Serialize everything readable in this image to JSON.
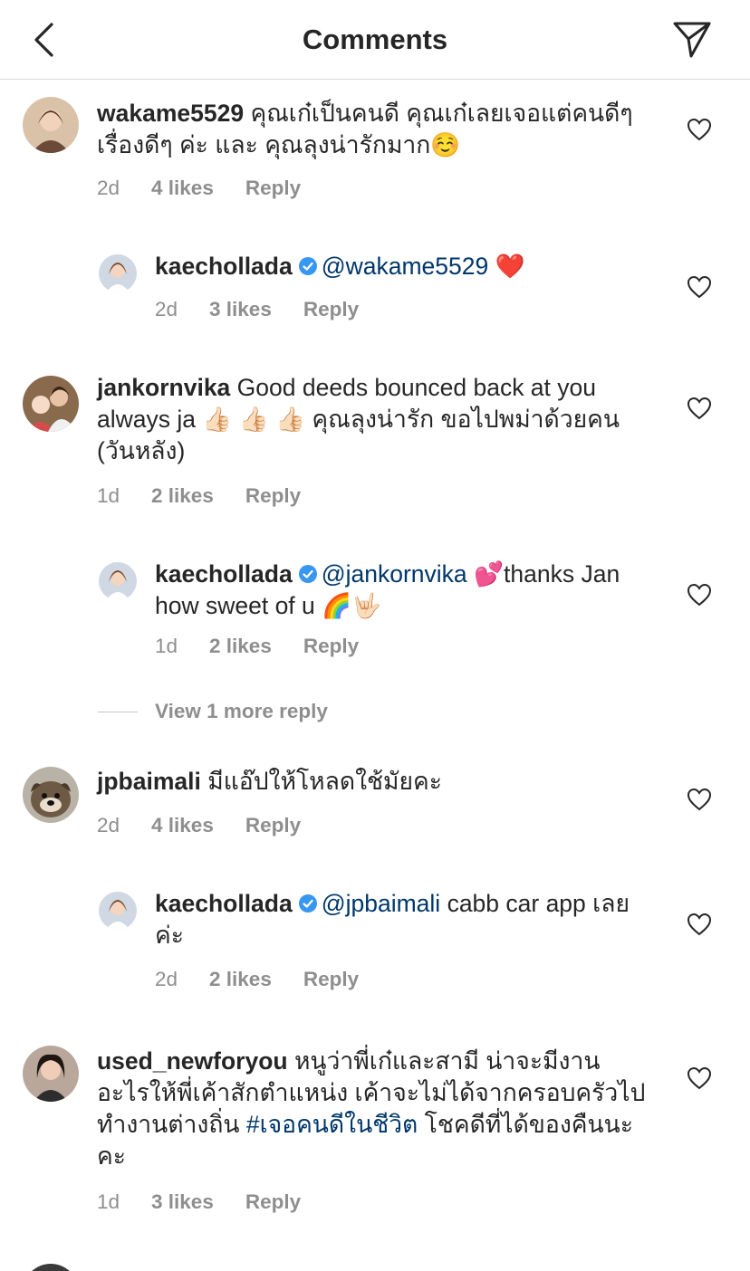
{
  "header": {
    "title": "Comments",
    "back_icon": "chevron-left-icon",
    "share_icon": "paper-plane-icon"
  },
  "comments": [
    {
      "username": "wakame5529",
      "text": "คุณเก๋เป็นคนดี คุณเก๋เลยเจอแต่คนดีๆ เรื่องดีๆ ค่ะ และ คุณลุงน่ารักมาก☺️",
      "time": "2d",
      "likes": "4 likes",
      "reply": "Reply",
      "replies": [
        {
          "username": "kaechollada",
          "verified": true,
          "mention": "@wakame5529",
          "text": " ❤️",
          "time": "2d",
          "likes": "3 likes",
          "reply": "Reply"
        }
      ]
    },
    {
      "username": "jankornvika",
      "text": "Good deeds bounced back at you always ja 👍🏻 👍🏻 👍🏻 คุณลุงน่ารัก ขอไปพม่าด้วยคน (วันหลัง)",
      "time": "1d",
      "likes": "2 likes",
      "reply": "Reply",
      "replies": [
        {
          "username": "kaechollada",
          "verified": true,
          "mention": "@jankornvika",
          "text": " 💕thanks Jan how sweet of u 🌈🤟🏻",
          "time": "1d",
          "likes": "2 likes",
          "reply": "Reply"
        }
      ],
      "view_more": "View 1 more reply"
    },
    {
      "username": "jpbaimali",
      "text": "มีแอ๊ปให้โหลดใช้มัยคะ",
      "time": "2d",
      "likes": "4 likes",
      "reply": "Reply",
      "replies": [
        {
          "username": "kaechollada",
          "verified": true,
          "mention": "@jpbaimali",
          "text": " cabb car app เลยค่ะ",
          "time": "2d",
          "likes": "2 likes",
          "reply": "Reply"
        }
      ]
    },
    {
      "username": "used_newforyou",
      "text_before": "หนูว่าพี่เก๋และสามี น่าจะมีงานอะไรให้พี่เค้าสักตำแหน่ง เค้าจะไม่ได้จากครอบครัวไปทำงานต่างถิ่น ",
      "hashtag": "#เจอคนดีในชีวิต",
      "text_after": " โชคดีที่ได้ของคืนนะคะ",
      "time": "1d",
      "likes": "3 likes",
      "reply": "Reply"
    }
  ],
  "colors": {
    "text": "#262626",
    "secondary": "#8e8e8e",
    "link": "#00376b",
    "verified": "#3897f0",
    "divider": "#dbdbdb"
  }
}
